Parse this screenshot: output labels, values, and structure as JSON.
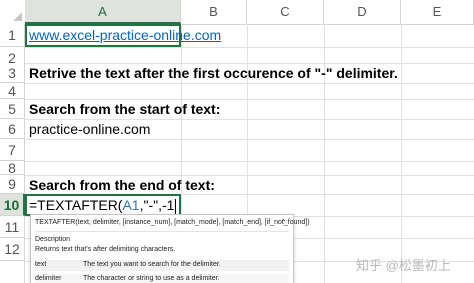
{
  "columns": [
    "A",
    "B",
    "C",
    "D",
    "E"
  ],
  "rows": [
    "1",
    "2",
    "3",
    "4",
    "5",
    "6",
    "7",
    "8",
    "9",
    "10",
    "11",
    "12"
  ],
  "cells": {
    "a1": "www.excel-practice-online.com",
    "a3": "Retrive the text after the first occurence of \"-\" delimiter.",
    "a5": "Search from the start of text:",
    "a6": "practice-online.com",
    "a9": "Search from the end of text:"
  },
  "formula": {
    "prefix": "=TEXTAFTER(",
    "ref": "A1",
    "suffix": ",\"-\",-1"
  },
  "tooltip": {
    "signature": "TEXTAFTER(text, delimiter, [instance_num], [match_mode], [match_end], [if_not_found])",
    "collapse_icon": "chevron-up",
    "description_title": "Description",
    "description": "Returns text that's after delimiting characters.",
    "param1_name": "text",
    "param1_desc": "The text you want to search for the delimiter.",
    "param2_name": "delimiter",
    "param2_desc": "The character or string to use as a delimiter."
  },
  "watermark": "知乎 @松墨初上",
  "colors": {
    "accent": "#217346",
    "link": "#0563c1",
    "ref": "#2e75b6"
  }
}
